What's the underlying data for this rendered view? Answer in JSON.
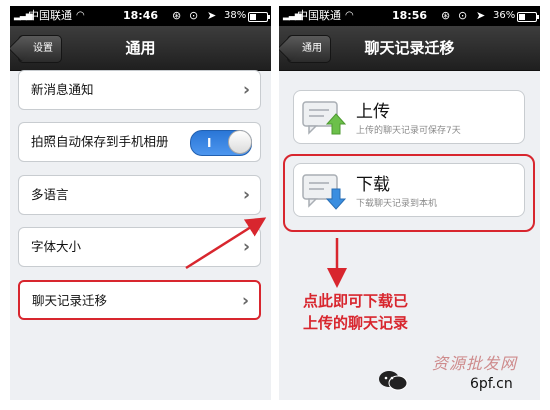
{
  "left_screen": {
    "status": {
      "carrier": "中国联通",
      "time": "18:46",
      "battery": "38%",
      "battery_fraction": 0.38
    },
    "nav": {
      "back_label": "设置",
      "title": "通用"
    },
    "items": [
      {
        "label": "新消息通知"
      },
      {
        "label": "拍照自动保存到手机相册",
        "toggle_text": "I",
        "toggle_on": true
      },
      {
        "label": "多语言"
      },
      {
        "label": "字体大小"
      },
      {
        "label": "聊天记录迁移"
      }
    ],
    "chevron": "›"
  },
  "right_screen": {
    "status": {
      "carrier": "中国联通",
      "time": "18:56",
      "battery": "36%",
      "battery_fraction": 0.36
    },
    "nav": {
      "back_label": "通用",
      "title": "聊天记录迁移"
    },
    "cards": [
      {
        "title": "上传",
        "subtitle": "上传的聊天记录可保存7天",
        "icon": "upload-chat-icon",
        "arrow_color": "#6cc04a"
      },
      {
        "title": "下载",
        "subtitle": "下载聊天记录到本机",
        "icon": "download-chat-icon",
        "arrow_color": "#3a8ee0"
      }
    ]
  },
  "annotation": {
    "line1": "点此即可下载已",
    "line2": "上传的聊天记录",
    "color": "#d8262e"
  },
  "watermark": {
    "text": "资源批发网",
    "site": "6pf.cn"
  }
}
